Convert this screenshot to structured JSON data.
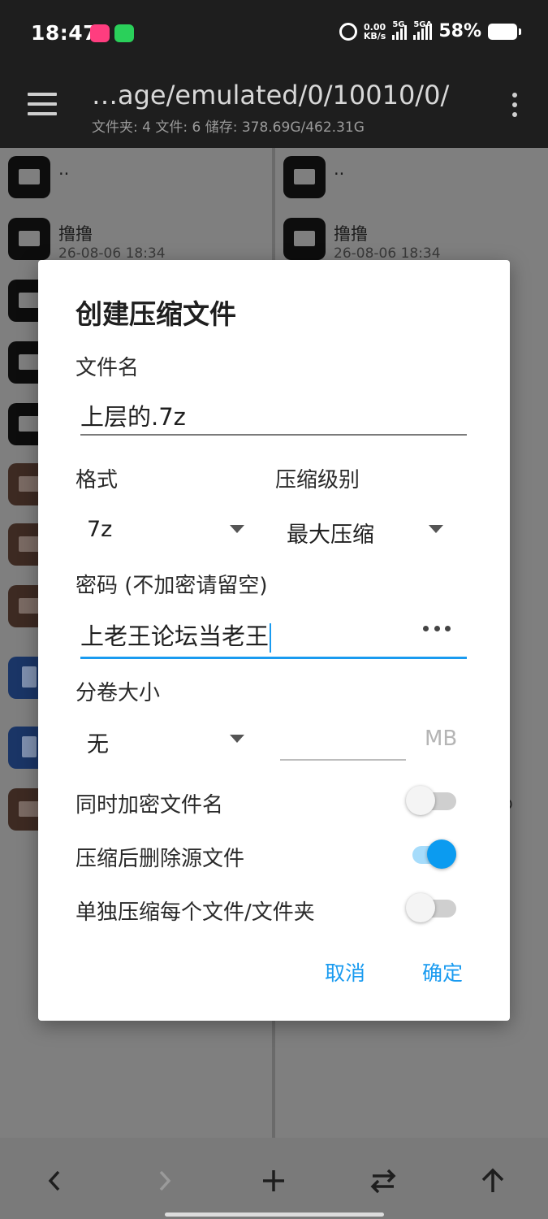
{
  "status_bar": {
    "time": "18:47",
    "net_speed_value": "0.00",
    "net_speed_unit": "KB/s",
    "sim1_label": "5G",
    "sim2_label": "5GA",
    "battery": "58%"
  },
  "app_bar": {
    "path": "…age/emulated/0/10010/0/",
    "summary": "文件夹: 4   文件: 6   储存: 378.69G/462.31G"
  },
  "left_pane": {
    "rows": [
      {
        "name": "..",
        "date": "",
        "type": "folder"
      },
      {
        "name": "撸撸",
        "date": "26-08-06 18:34",
        "type": "folder"
      },
      {
        "name": "",
        "date": "",
        "type": "folder"
      },
      {
        "name": "",
        "date": "",
        "type": "folder"
      },
      {
        "name": "",
        "date": "",
        "type": "folder"
      },
      {
        "name": "",
        "date": "",
        "type": "archive"
      },
      {
        "name": "",
        "date": "",
        "type": "archive"
      },
      {
        "name": "",
        "date": "",
        "type": "archive"
      },
      {
        "name": "",
        "date": "",
        "type": "document"
      },
      {
        "name": "",
        "date": "",
        "type": "document"
      },
      {
        "name": "",
        "date": "",
        "type": "archive"
      }
    ]
  },
  "right_pane": {
    "rows": [
      {
        "name": "..",
        "date": "",
        "type": "folder"
      },
      {
        "name": "撸撸",
        "date": "26-08-06 18:34",
        "type": "folder"
      }
    ],
    "stray_text": "p"
  },
  "dialog": {
    "title": "创建压缩文件",
    "filename_label": "文件名",
    "filename_value": "上层的.7z",
    "format_label": "格式",
    "format_value": "7z",
    "level_label": "压缩级别",
    "level_value": "最大压缩",
    "password_label": "密码 (不加密请留空)",
    "password_value": "上老王论坛当老王",
    "volume_label": "分卷大小",
    "volume_value": "无",
    "volume_size_value": "",
    "volume_unit": "MB",
    "toggles": [
      {
        "label": "同时加密文件名",
        "on": false
      },
      {
        "label": "压缩后删除源文件",
        "on": true
      },
      {
        "label": "单独压缩每个文件/文件夹",
        "on": false
      }
    ],
    "cancel_label": "取消",
    "ok_label": "确定"
  },
  "bottom_bar": {
    "back_icon": "chevron-left-icon",
    "forward_icon": "chevron-right-icon",
    "add_icon": "plus-icon",
    "swap_icon": "swap-icon",
    "up_icon": "arrow-up-icon"
  },
  "colors": {
    "accent": "#1a9bf0",
    "scrim_pane": "#7f7f7f",
    "app_bar": "#1e1e1e"
  }
}
